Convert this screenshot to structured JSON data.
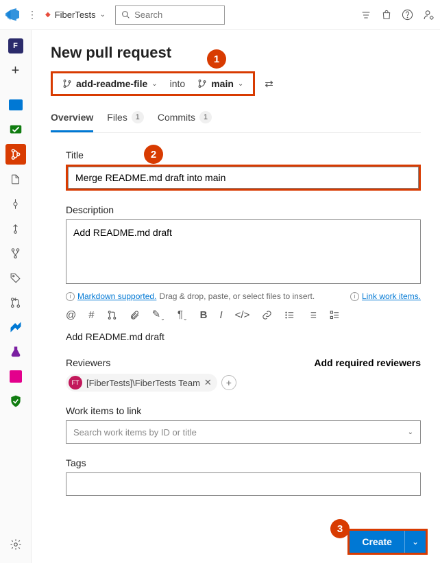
{
  "top": {
    "project": "FiberTests",
    "search_placeholder": "Search"
  },
  "page": {
    "title": "New pull request",
    "source_branch": "add-readme-file",
    "into": "into",
    "target_branch": "main"
  },
  "tabs": {
    "overview": "Overview",
    "files": "Files",
    "files_count": "1",
    "commits": "Commits",
    "commits_count": "1"
  },
  "form": {
    "title_label": "Title",
    "title_value": "Merge README.md draft into main",
    "desc_label": "Description",
    "desc_value": "Add README.md draft",
    "markdown_hint": "Markdown supported.",
    "drag_hint": " Drag & drop, paste, or select files to insert.",
    "link_work": "Link work items.",
    "preview": "Add README.md draft",
    "reviewers_label": "Reviewers",
    "add_required": "Add required reviewers",
    "reviewer_pill": "[FiberTests]\\FiberTests Team",
    "work_items_label": "Work items to link",
    "work_items_placeholder": "Search work items by ID or title",
    "tags_label": "Tags"
  },
  "footer": {
    "create": "Create"
  },
  "callouts": {
    "c1": "1",
    "c2": "2",
    "c3": "3"
  }
}
